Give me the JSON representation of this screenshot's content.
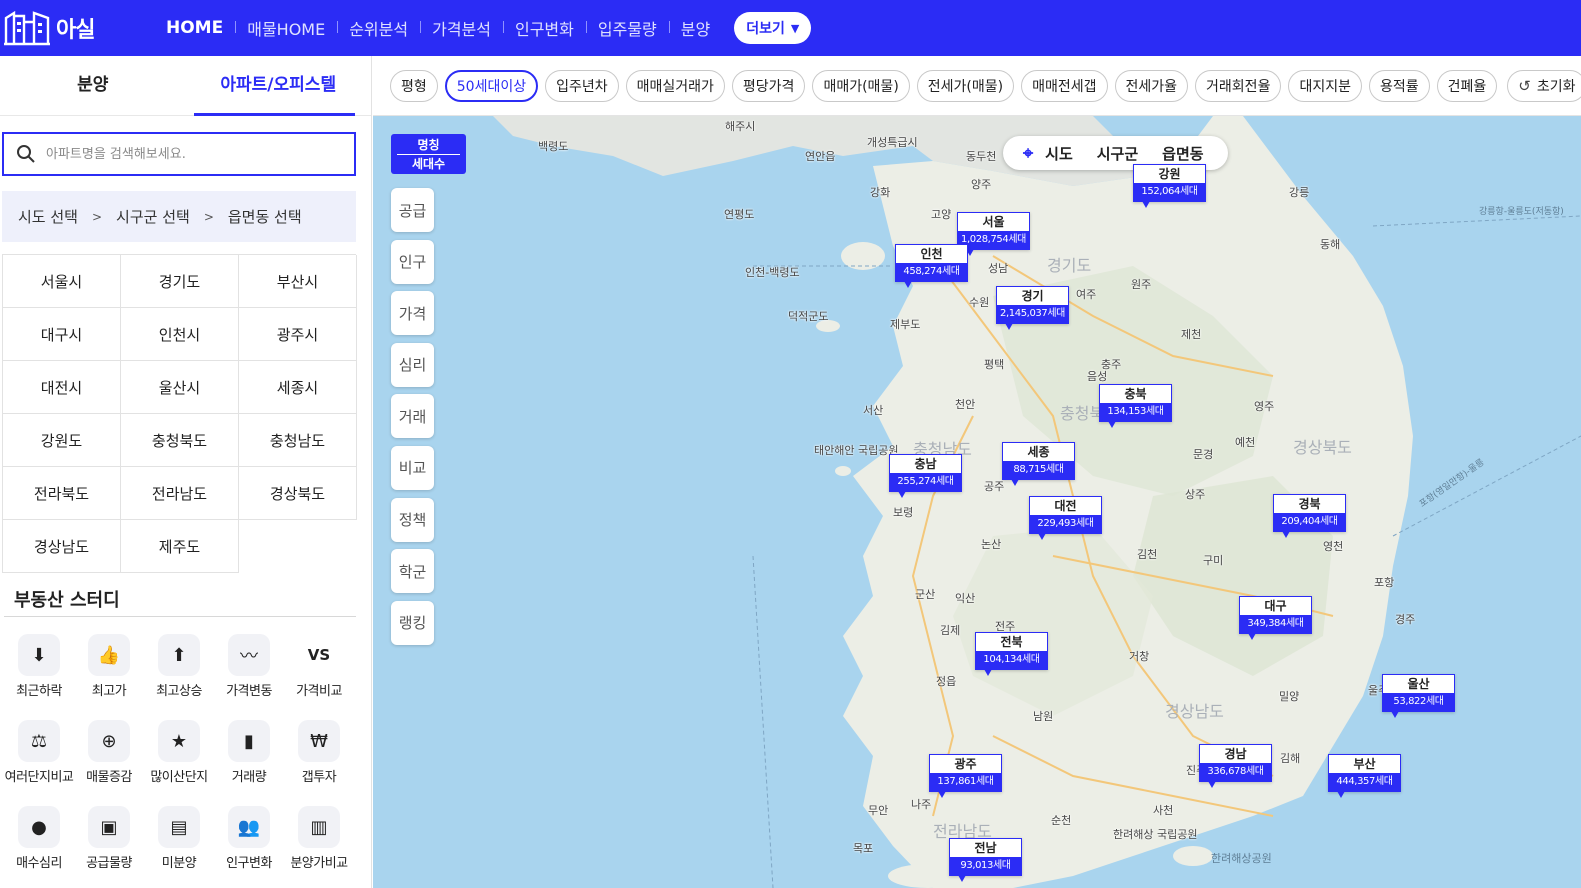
{
  "header": {
    "logo_text": "아실",
    "nav": [
      "HOME",
      "매물HOME",
      "순위분석",
      "가격분석",
      "인구변화",
      "입주물량",
      "분양"
    ],
    "more_label": "더보기"
  },
  "left_panel": {
    "tabs": [
      "분양",
      "아파트/오피스텔"
    ],
    "search_placeholder": "아파트명을 검색해보세요.",
    "breadcrumb": [
      "시도 선택",
      "시구군 선택",
      "읍면동 선택"
    ],
    "breadcrumb_sep": ">",
    "regions": [
      "서울시",
      "경기도",
      "부산시",
      "대구시",
      "인천시",
      "광주시",
      "대전시",
      "울산시",
      "세종시",
      "강원도",
      "충청북도",
      "충청남도",
      "전라북도",
      "전라남도",
      "경상북도",
      "경상남도",
      "제주도"
    ],
    "study_title": "부동산 스터디",
    "study_items": [
      {
        "label": "최근하락",
        "icon": "price-down-icon",
        "glyph": "⬇"
      },
      {
        "label": "최고가",
        "icon": "thumbs-up-icon",
        "glyph": "👍"
      },
      {
        "label": "최고상승",
        "icon": "price-up-icon",
        "glyph": "⬆"
      },
      {
        "label": "가격변동",
        "icon": "pulse-icon",
        "glyph": "〰"
      },
      {
        "label": "가격비교",
        "icon": "vs-icon",
        "glyph": "VS"
      },
      {
        "label": "여러단지비교",
        "icon": "scale-icon",
        "glyph": "⚖"
      },
      {
        "label": "매물증감",
        "icon": "listing-change-icon",
        "glyph": "⊕"
      },
      {
        "label": "많이산단지",
        "icon": "shield-star-icon",
        "glyph": "★"
      },
      {
        "label": "거래량",
        "icon": "bar-chart-icon",
        "glyph": "▮"
      },
      {
        "label": "갭투자",
        "icon": "money-bag-icon",
        "glyph": "₩"
      },
      {
        "label": "매수심리",
        "icon": "head-icon",
        "glyph": "●"
      },
      {
        "label": "공급물량",
        "icon": "supply-icon",
        "glyph": "▣"
      },
      {
        "label": "미분양",
        "icon": "unsold-icon",
        "glyph": "▤"
      },
      {
        "label": "인구변화",
        "icon": "people-icon",
        "glyph": "👥"
      },
      {
        "label": "분양가비교",
        "icon": "compare-bars-icon",
        "glyph": "▥"
      }
    ]
  },
  "filters": {
    "chips": [
      "평형",
      "50세대이상",
      "입주년차",
      "매매실거래가",
      "평당가격",
      "매매가(매물)",
      "전세가(매물)",
      "매매전세갭",
      "전세가율",
      "거래회전율",
      "대지지분",
      "용적률",
      "건폐율"
    ],
    "active_chip": "50세대이상",
    "reset_label": "초기화"
  },
  "map": {
    "legend": {
      "line1": "명칭",
      "line2": "세대수"
    },
    "side_tools": [
      "공급",
      "인구",
      "가격",
      "심리",
      "거래",
      "비교",
      "정책",
      "학군",
      "랭킹"
    ],
    "level_switch": [
      "시도",
      "시구군",
      "읍면동"
    ],
    "regions": [
      {
        "name": "강원",
        "count": "152,064세대"
      },
      {
        "name": "서울",
        "count": "1,028,754세대"
      },
      {
        "name": "인천",
        "count": "458,274세대"
      },
      {
        "name": "경기",
        "count": "2,145,037세대"
      },
      {
        "name": "충북",
        "count": "134,153세대"
      },
      {
        "name": "세종",
        "count": "88,715세대"
      },
      {
        "name": "충남",
        "count": "255,274세대"
      },
      {
        "name": "대전",
        "count": "229,493세대"
      },
      {
        "name": "경북",
        "count": "209,404세대"
      },
      {
        "name": "대구",
        "count": "349,384세대"
      },
      {
        "name": "전북",
        "count": "104,134세대"
      },
      {
        "name": "울산",
        "count": "53,822세대"
      },
      {
        "name": "경남",
        "count": "336,678세대"
      },
      {
        "name": "부산",
        "count": "444,357세대"
      },
      {
        "name": "광주",
        "count": "137,861세대"
      },
      {
        "name": "전남",
        "count": "93,013세대"
      }
    ],
    "places": [
      "해주시",
      "개성특급시",
      "백령도",
      "연안읍",
      "동두천",
      "양주",
      "강화",
      "고양",
      "연평도",
      "인천-백령도",
      "성남",
      "여주",
      "원주",
      "강릉",
      "동해",
      "덕적군도",
      "제부도",
      "수원",
      "충주",
      "제천",
      "평택",
      "음성",
      "천안",
      "서산",
      "영주",
      "예천",
      "문경",
      "상주",
      "공주",
      "보령",
      "논산",
      "김천",
      "구미",
      "영천",
      "포항",
      "군산",
      "익산",
      "전주",
      "김제",
      "정읍",
      "거창",
      "경주",
      "울주",
      "밀양",
      "남원",
      "진주",
      "김해",
      "무안",
      "나주",
      "순천",
      "사천",
      "목포",
      "경기도",
      "충청북도",
      "충청남도",
      "경상북도",
      "경상남도",
      "전라남도",
      "태안해안 국립공원",
      "한려해상 국립공원",
      "한려해상공원",
      "강릉항-울릉도(저동항)",
      "포항(영일만항)-울릉"
    ]
  }
}
